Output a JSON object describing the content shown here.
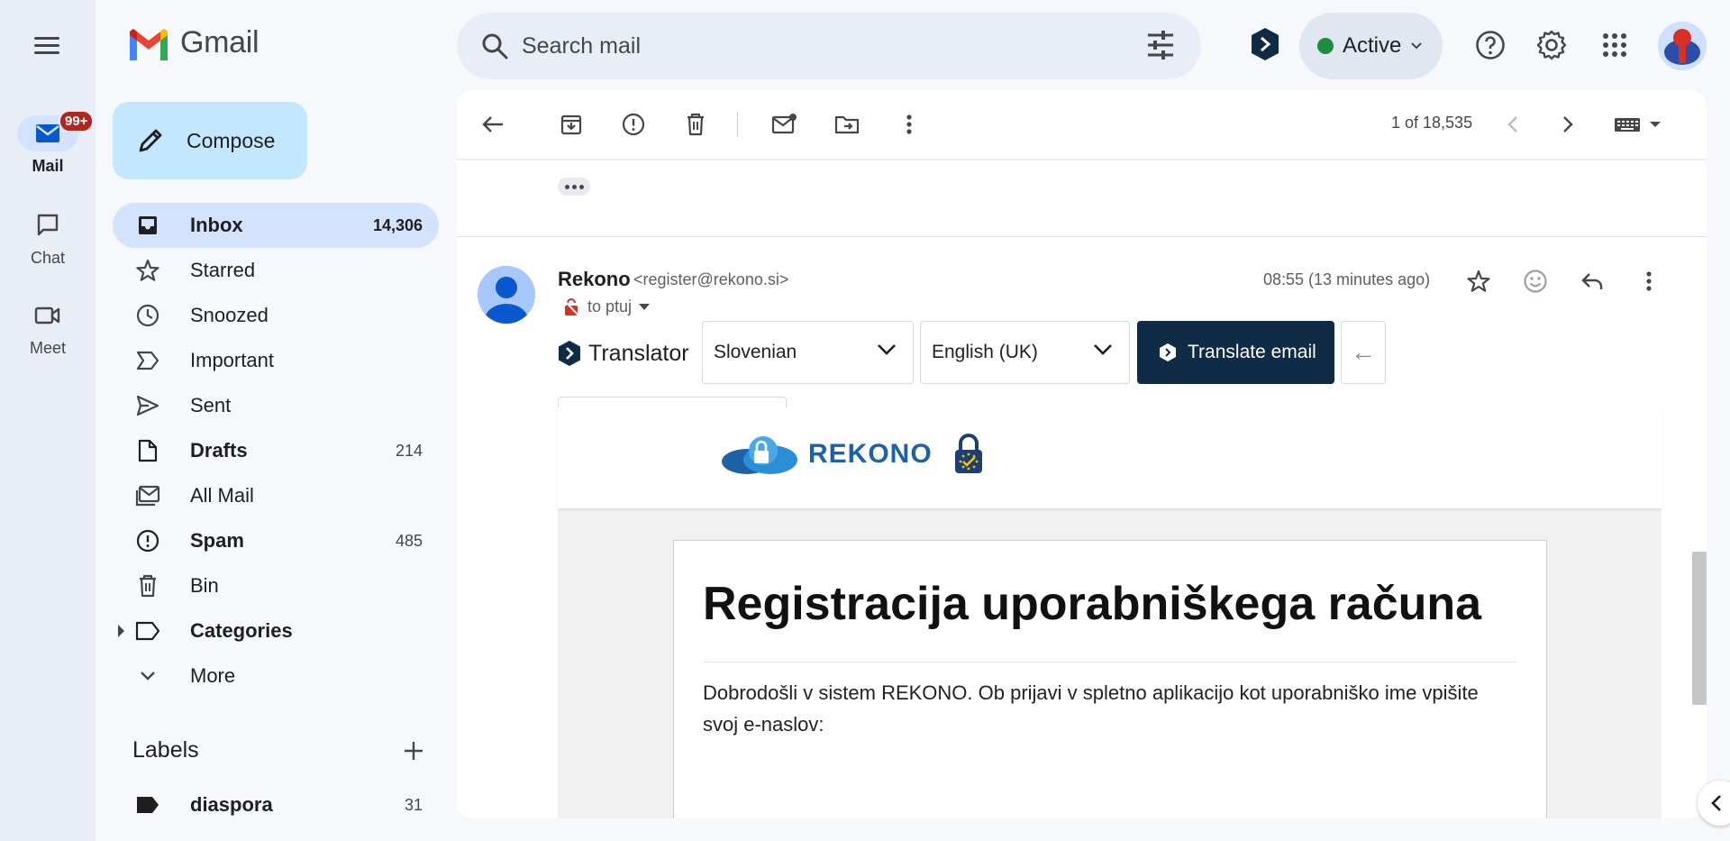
{
  "app": {
    "name": "Gmail"
  },
  "rail": {
    "items": [
      {
        "label": "Mail",
        "badge": "99+"
      },
      {
        "label": "Chat"
      },
      {
        "label": "Meet"
      }
    ]
  },
  "search": {
    "placeholder": "Search mail"
  },
  "status": {
    "label": "Active",
    "color": "#1e8e3e"
  },
  "compose": {
    "label": "Compose"
  },
  "nav": {
    "items": [
      {
        "label": "Inbox",
        "count": "14,306"
      },
      {
        "label": "Starred"
      },
      {
        "label": "Snoozed"
      },
      {
        "label": "Important"
      },
      {
        "label": "Sent"
      },
      {
        "label": "Drafts",
        "count": "214"
      },
      {
        "label": "All Mail"
      },
      {
        "label": "Spam",
        "count": "485"
      },
      {
        "label": "Bin"
      },
      {
        "label": "Categories"
      },
      {
        "label": "More"
      }
    ]
  },
  "labels": {
    "heading": "Labels",
    "items": [
      {
        "label": "diaspora",
        "count": "31"
      }
    ]
  },
  "toolbar": {
    "pager": "1 of 18,535"
  },
  "message": {
    "sender_name": "Rekono",
    "sender_email": "<register@rekono.si>",
    "to": "to ptuj",
    "time": "08:55 (13 minutes ago)"
  },
  "translator": {
    "brand": "Translator",
    "source_lang": "Slovenian",
    "target_lang": "English (UK)",
    "translate_label": "Translate email",
    "back_label": "←"
  },
  "email": {
    "logo_text": "REKONO",
    "title": "Registracija uporabniškega računa",
    "body": "Dobrodošli v sistem REKONO. Ob prijavi v spletno aplikacijo kot uporabniško ime vpišite svoj e-naslov:"
  },
  "colors": {
    "accent": "#0b57d0",
    "translate_button": "#0f2b46",
    "badge": "#b3261e"
  }
}
